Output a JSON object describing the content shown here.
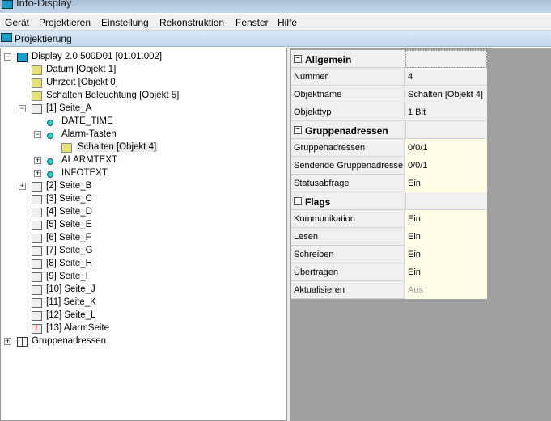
{
  "window": {
    "title": "Info-Display"
  },
  "menu": [
    "Gerät",
    "Projektieren",
    "Einstellung",
    "Rekonstruktion",
    "Fenster",
    "Hilfe"
  ],
  "panel": {
    "title": "Projektierung"
  },
  "tree": [
    {
      "label": "Display 2.0 500D01 [01.01.002]",
      "level": 0,
      "icon": "disp",
      "exp": "-"
    },
    {
      "label": "Datum [Objekt 1]",
      "level": 1,
      "icon": "obj"
    },
    {
      "label": "Uhrzeit [Objekt 0]",
      "level": 1,
      "icon": "obj"
    },
    {
      "label": "Schalten Beleuchtung [Objekt 5]",
      "level": 1,
      "icon": "obj"
    },
    {
      "label": "[1] Seite_A",
      "level": 1,
      "icon": "page",
      "exp": "-"
    },
    {
      "label": "DATE_TIME",
      "level": 2,
      "icon": "ctl"
    },
    {
      "label": "Alarm-Tasten",
      "level": 2,
      "icon": "ctl",
      "exp": "-"
    },
    {
      "label": "Schalten [Objekt 4]",
      "level": 3,
      "icon": "obj",
      "selected": true
    },
    {
      "label": "ALARMTEXT",
      "level": 2,
      "icon": "ctl",
      "exp": "+"
    },
    {
      "label": "INFOTEXT",
      "level": 2,
      "icon": "ctl",
      "exp": "+"
    },
    {
      "label": "[2] Seite_B",
      "level": 1,
      "icon": "page",
      "exp": "+"
    },
    {
      "label": "[3] Seite_C",
      "level": 1,
      "icon": "page"
    },
    {
      "label": "[4] Seite_D",
      "level": 1,
      "icon": "page"
    },
    {
      "label": "[5] Seite_E",
      "level": 1,
      "icon": "page"
    },
    {
      "label": "[6] Seite_F",
      "level": 1,
      "icon": "page"
    },
    {
      "label": "[7] Seite_G",
      "level": 1,
      "icon": "page"
    },
    {
      "label": "[8] Seite_H",
      "level": 1,
      "icon": "page"
    },
    {
      "label": "[9] Seite_I",
      "level": 1,
      "icon": "page"
    },
    {
      "label": "[10] Seite_J",
      "level": 1,
      "icon": "page"
    },
    {
      "label": "[11] Seite_K",
      "level": 1,
      "icon": "page"
    },
    {
      "label": "[12] Seite_L",
      "level": 1,
      "icon": "page"
    },
    {
      "label": "[13] AlarmSeite",
      "level": 1,
      "icon": "alarm"
    },
    {
      "label": "Gruppenadressen",
      "level": 0,
      "icon": "grp",
      "exp": "+"
    }
  ],
  "properties": [
    {
      "type": "cat",
      "key": "Allgemein"
    },
    {
      "key": "Nummer",
      "value": "4"
    },
    {
      "key": "Objektname",
      "value": "Schalten [Objekt 4]"
    },
    {
      "key": "Objekttyp",
      "value": "1 Bit"
    },
    {
      "type": "cat",
      "key": "Gruppenadressen"
    },
    {
      "key": "Gruppenadressen",
      "value": "0/0/1",
      "editable": true
    },
    {
      "key": "Sendende Gruppenadresse",
      "value": "0/0/1",
      "editable": true
    },
    {
      "key": "Statusabfrage",
      "value": "Ein",
      "editable": true
    },
    {
      "type": "cat",
      "key": "Flags"
    },
    {
      "key": "Kommunikation",
      "value": "Ein",
      "editable": true
    },
    {
      "key": "Lesen",
      "value": "Ein",
      "editable": true
    },
    {
      "key": "Schreiben",
      "value": "Ein",
      "editable": true
    },
    {
      "key": "Übertragen",
      "value": "Ein",
      "editable": true
    },
    {
      "key": "Aktualisieren",
      "value": "Aus",
      "editable": true,
      "disabled": true
    }
  ]
}
